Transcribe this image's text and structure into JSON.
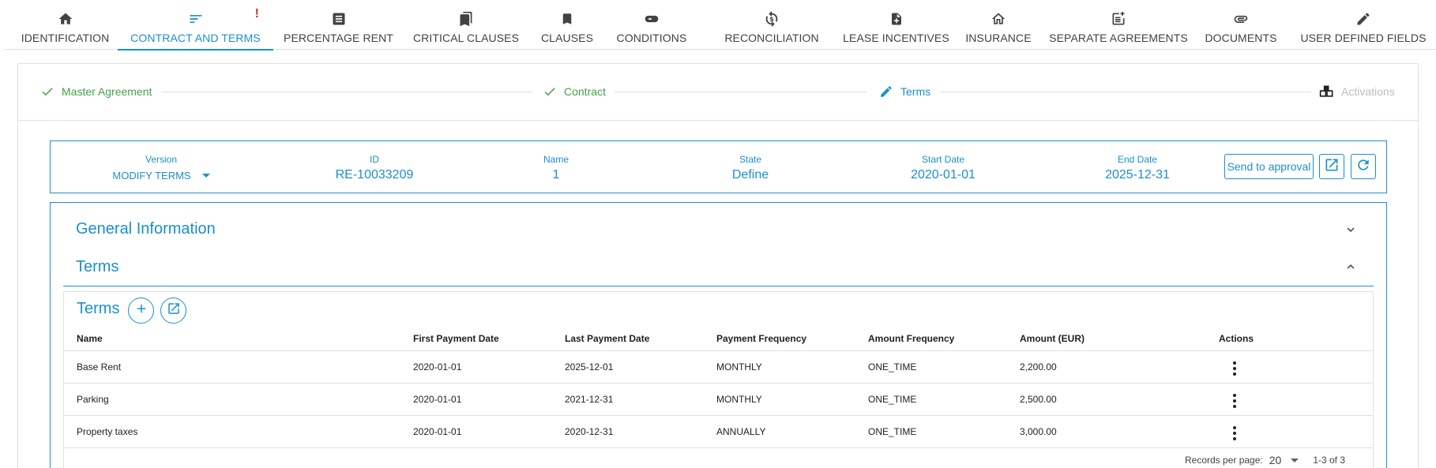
{
  "tabs": [
    {
      "label": "IDENTIFICATION",
      "icon": "home-icon"
    },
    {
      "label": "CONTRACT AND TERMS",
      "icon": "list-icon",
      "active": true,
      "warning": "!"
    },
    {
      "label": "PERCENTAGE RENT",
      "icon": "document-icon"
    },
    {
      "label": "CRITICAL CLAUSES",
      "icon": "bookmarks-icon"
    },
    {
      "label": "CLAUSES",
      "icon": "bookmark-icon"
    },
    {
      "label": "CONDITIONS",
      "icon": "gamepad-icon"
    },
    {
      "label": "RECONCILIATION",
      "icon": "dollar-sync-icon"
    },
    {
      "label": "LEASE INCENTIVES",
      "icon": "file-plus-icon"
    },
    {
      "label": "INSURANCE",
      "icon": "house-roof-icon"
    },
    {
      "label": "SEPARATE AGREEMENTS",
      "icon": "note-plus-icon"
    },
    {
      "label": "DOCUMENTS",
      "icon": "paperclip-icon"
    },
    {
      "label": "USER DEFINED FIELDS",
      "icon": "pencil-icon"
    }
  ],
  "stepper": {
    "steps": [
      {
        "label": "Master Agreement",
        "status": "done"
      },
      {
        "label": "Contract",
        "status": "done"
      },
      {
        "label": "Terms",
        "status": "editing"
      },
      {
        "label": "Activations",
        "status": "pending"
      }
    ]
  },
  "version": {
    "version_label": "Version",
    "version_value": "MODIFY TERMS",
    "id_label": "ID",
    "id_value": "RE-10033209",
    "name_label": "Name",
    "name_value": "1",
    "state_label": "State",
    "state_value": "Define",
    "start_label": "Start Date",
    "start_value": "2020-01-01",
    "end_label": "End Date",
    "end_value": "2025-12-31",
    "approval_button": "Send to approval"
  },
  "sections": {
    "general": "General Information",
    "terms": "Terms"
  },
  "terms_table": {
    "title": "Terms",
    "columns": [
      "Name",
      "First Payment Date",
      "Last Payment Date",
      "Payment Frequency",
      "Amount Frequency",
      "Amount (EUR)",
      "Actions"
    ],
    "rows": [
      [
        "Base Rent",
        "2020-01-01",
        "2025-12-01",
        "MONTHLY",
        "ONE_TIME",
        "2,200.00"
      ],
      [
        "Parking",
        "2020-01-01",
        "2021-12-31",
        "MONTHLY",
        "ONE_TIME",
        "2,500.00"
      ],
      [
        "Property taxes",
        "2020-01-01",
        "2020-12-31",
        "ANNUALLY",
        "ONE_TIME",
        "3,000.00"
      ]
    ],
    "records_per_page_label": "Records per page:",
    "records_per_page_value": "20",
    "range": "1-3 of 3"
  },
  "colors": {
    "accent": "#1b8fd0",
    "done": "#43a047",
    "warning": "#d32f2f"
  }
}
